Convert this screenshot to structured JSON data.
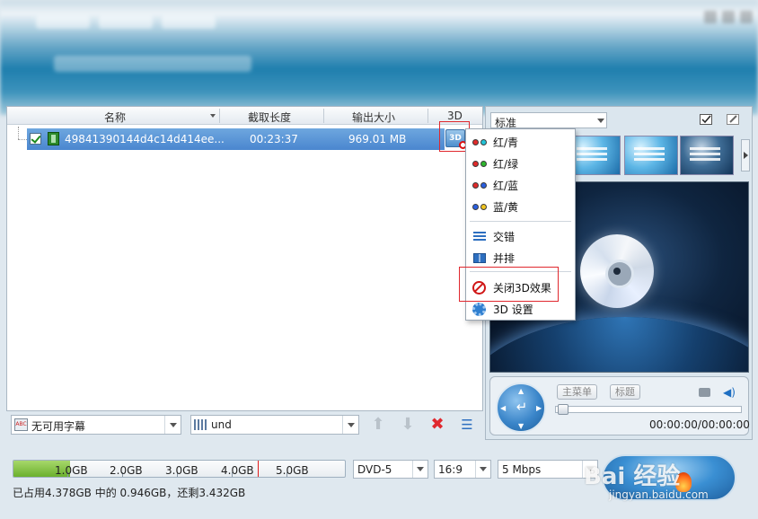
{
  "list": {
    "columns": {
      "name": "名称",
      "clip_length": "截取长度",
      "output_size": "输出大小",
      "three_d": "3D"
    },
    "rows": [
      {
        "checked": true,
        "name": "49841390144d4c14d414ee...",
        "clip_length": "00:23:37",
        "output_size": "969.01 MB"
      }
    ]
  },
  "context_menu": {
    "items": [
      {
        "label": "红/青",
        "icon": "red-cyan-glasses-icon"
      },
      {
        "label": "红/绿",
        "icon": "red-green-glasses-icon"
      },
      {
        "label": "红/蓝",
        "icon": "red-blue-glasses-icon"
      },
      {
        "label": "蓝/黄",
        "icon": "blue-yellow-glasses-icon"
      },
      {
        "label": "交错",
        "icon": "interlace-icon"
      },
      {
        "label": "并排",
        "icon": "side-by-side-icon"
      },
      {
        "label": "关闭3D效果",
        "icon": "disable-3d-icon"
      },
      {
        "label": "3D 设置",
        "icon": "gear-icon"
      }
    ]
  },
  "left_toolbar": {
    "subtitle_value": "无可用字幕",
    "audio_value": "und"
  },
  "right_panel": {
    "template_value": "标准",
    "main_menu_button": "主菜单",
    "title_button": "标题",
    "time_display": "00:00:00/00:00:00",
    "nav_enter_symbol": "↵"
  },
  "bottom": {
    "capacity_labels": [
      "1.0GB",
      "2.0GB",
      "3.0GB",
      "4.0GB",
      "5.0GB"
    ],
    "capacity_used_fraction": 0.17,
    "disc_type": "DVD-5",
    "aspect_ratio": "16:9",
    "bitrate": "5 Mbps",
    "status_text": "已占用4.378GB 中的 0.946GB，还剩3.432GB"
  },
  "watermark": {
    "brand": "Bai 经验",
    "url": "jingyan.baidu.com"
  },
  "colors": {
    "selection": "#4a86cf",
    "highlight_box": "#e0282e",
    "capacity_fill": "#6bb02d"
  }
}
